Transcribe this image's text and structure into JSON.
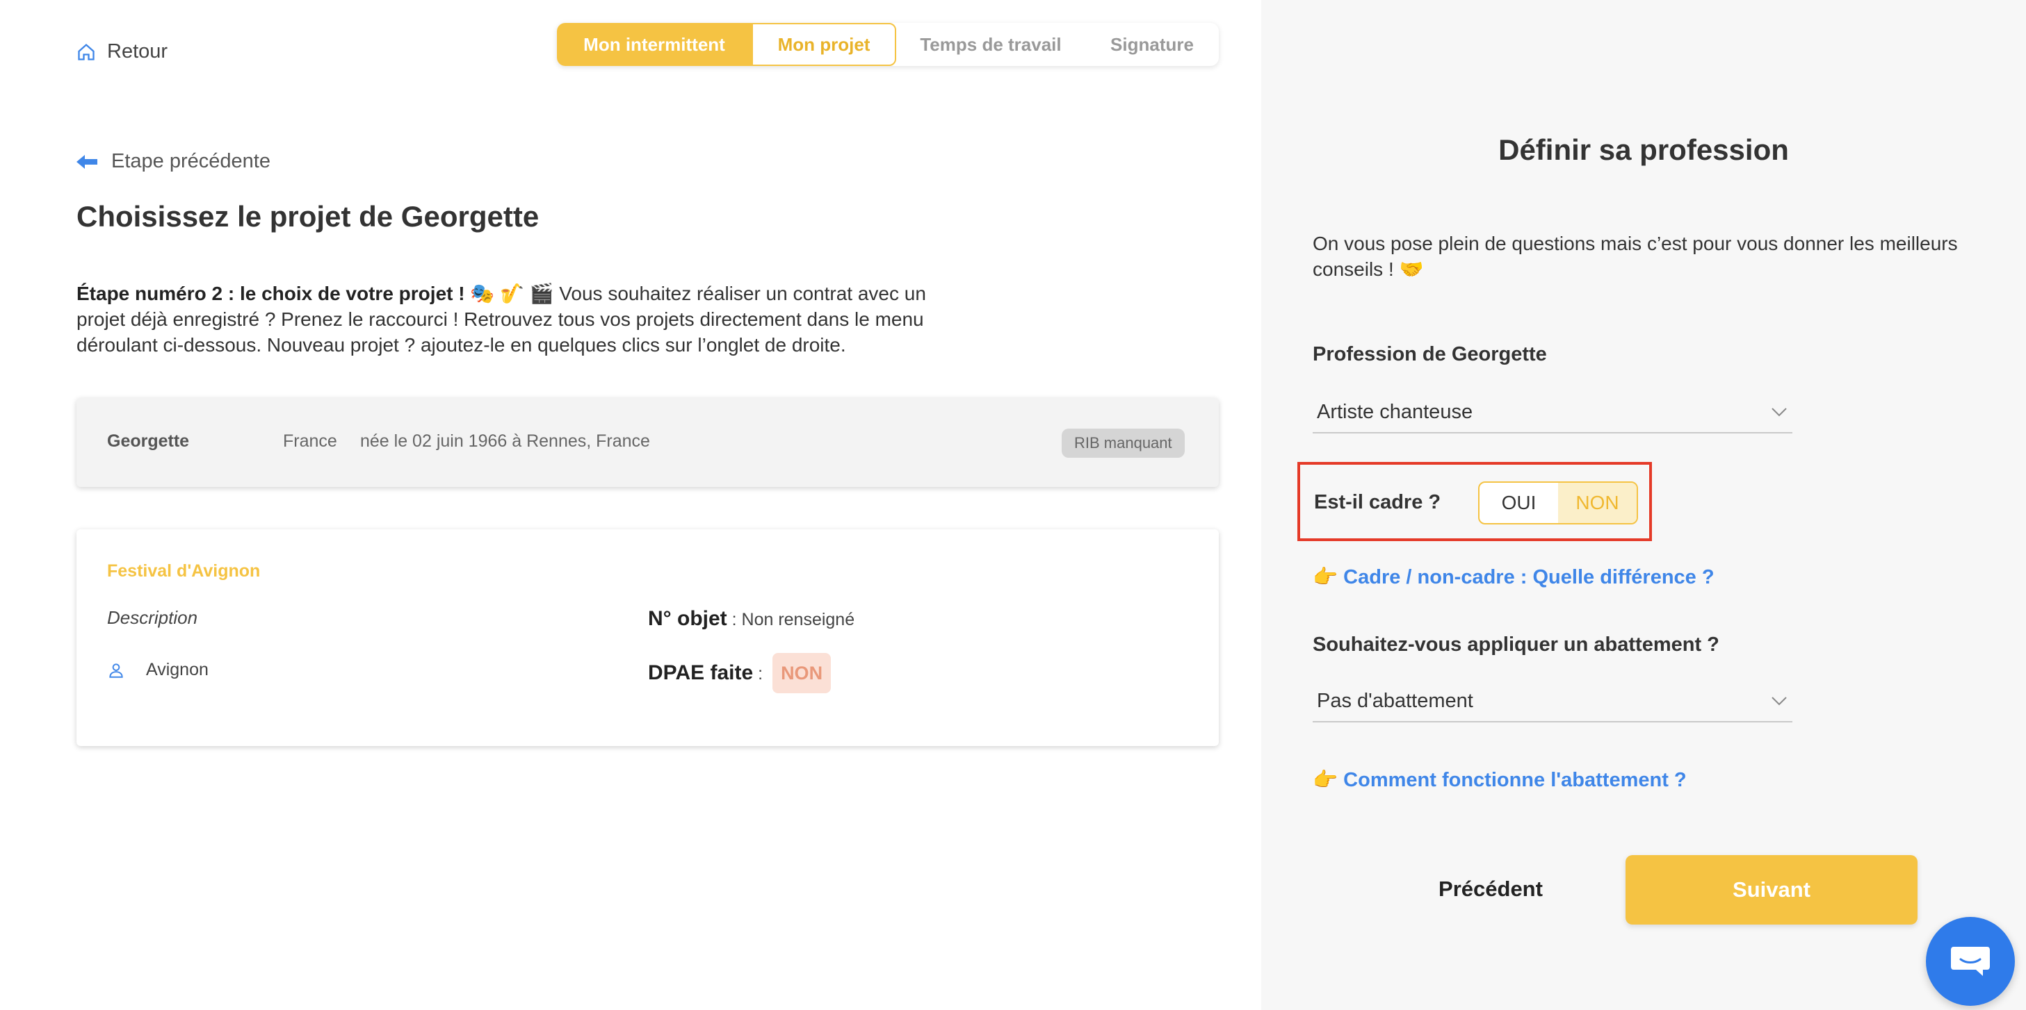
{
  "nav": {
    "back_label": "Retour"
  },
  "stepper": {
    "steps": [
      {
        "label": "Mon intermittent"
      },
      {
        "label": "Mon projet"
      },
      {
        "label": "Temps de travail"
      },
      {
        "label": "Signature"
      }
    ]
  },
  "left": {
    "prev_step_label": "Etape précédente",
    "title": "Choisissez le projet de Georgette",
    "intro_bold": "Étape numéro 2 : le choix de votre projet ! 🎭 🎷 🎬",
    "intro_text": " Vous souhaitez réaliser un contrat avec un projet déjà enregistré ? Prenez le raccourci ! Retrouvez tous vos projets directement dans le menu déroulant ci-dessous. Nouveau projet ? ajoutez-le en quelques clics sur l’onglet de droite.",
    "person": {
      "name": "Georgette",
      "country": "France",
      "birth": "née le 02 juin 1966 à Rennes, France",
      "badge": "RIB manquant"
    },
    "project": {
      "title": "Festival d'Avignon",
      "description_label": "Description",
      "location": "Avignon",
      "object_label": "N° objet",
      "object_value": " : Non renseigné",
      "dpae_label": "DPAE faite",
      "dpae_sep": " :",
      "dpae_value": "NON"
    }
  },
  "right": {
    "title": "Définir sa profession",
    "subtitle": "On vous pose plein de questions mais c’est pour vous donner les meilleurs conseils ! 🤝",
    "profession_label": "Profession de Georgette",
    "profession_value": "Artiste chanteuse",
    "cadre_label": "Est-il cadre ?",
    "cadre_options": [
      "OUI",
      "NON"
    ],
    "cadre_selected": "NON",
    "cadre_link": "👉 Cadre / non-cadre : Quelle différence ?",
    "abattement_label": "Souhaitez-vous appliquer un abattement ?",
    "abattement_value": "Pas d'abattement",
    "abattement_link": "👉 Comment fonctionne l'abattement ?",
    "prev_button": "Précédent",
    "next_button": "Suivant"
  },
  "colors": {
    "accent": "#f5c343",
    "link": "#3f86e8",
    "highlight": "#e53a28",
    "chat": "#2f7bea"
  }
}
